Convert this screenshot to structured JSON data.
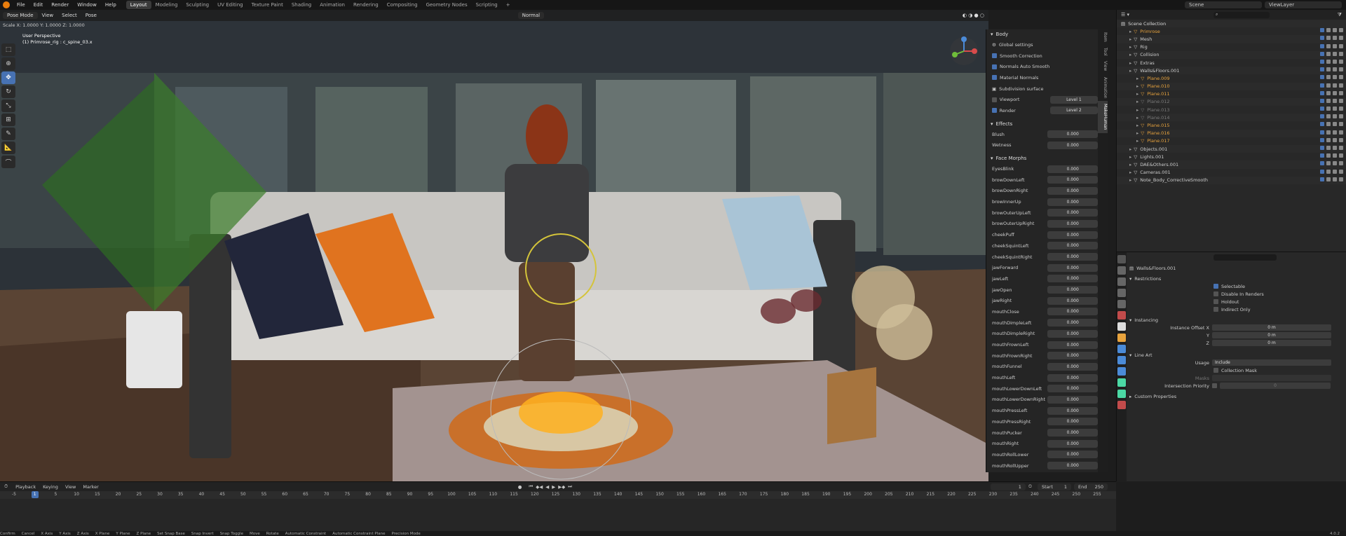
{
  "menu": [
    "File",
    "Edit",
    "Render",
    "Window",
    "Help"
  ],
  "workspaces": [
    "Layout",
    "Modeling",
    "Sculpting",
    "UV Editing",
    "Texture Paint",
    "Shading",
    "Animation",
    "Rendering",
    "Compositing",
    "Geometry Nodes",
    "Scripting",
    "+"
  ],
  "active_workspace": "Layout",
  "scene_name": "Scene",
  "view_layer": "ViewLayer",
  "viewport": {
    "mode": "Pose Mode",
    "menus": [
      "View",
      "Select",
      "Pose"
    ],
    "orientation": "Normal",
    "scale_readout": "Scale X: 1.0000   Y: 1.0000   Z: 1.0000",
    "perspective": "User Perspective",
    "active_object": "(1) Primrose_rig : c_spine_03.x"
  },
  "npanel": {
    "tabs": [
      "Item",
      "Tool",
      "View",
      "Animation",
      "MakeHuman"
    ],
    "active_tab": "MakeHuman",
    "body_title": "Body",
    "global_settings": "Global settings",
    "checks": [
      {
        "label": "Smooth Correction",
        "on": true
      },
      {
        "label": "Normals Auto Smooth",
        "on": true
      },
      {
        "label": "Material Normals",
        "on": true
      }
    ],
    "subdivision_title": "Subdivision surface",
    "subdiv": [
      {
        "label": "Viewport",
        "on": false,
        "field": "Level",
        "value": "1"
      },
      {
        "label": "Render",
        "on": true,
        "field": "Level",
        "value": "2"
      }
    ],
    "effects_title": "Effects",
    "effects": [
      {
        "label": "Blush",
        "value": "0.000"
      },
      {
        "label": "Wetness",
        "value": "0.000"
      }
    ],
    "morphs_title": "Face Morphs",
    "morphs": [
      {
        "label": "EyesBlink",
        "value": "0.000"
      },
      {
        "label": "browDownLeft",
        "value": "0.000"
      },
      {
        "label": "browDownRight",
        "value": "0.000"
      },
      {
        "label": "browInnerUp",
        "value": "0.000"
      },
      {
        "label": "browOuterUpLeft",
        "value": "0.000"
      },
      {
        "label": "browOuterUpRight",
        "value": "0.000"
      },
      {
        "label": "cheekPuff",
        "value": "0.000"
      },
      {
        "label": "cheekSquintLeft",
        "value": "0.000"
      },
      {
        "label": "cheekSquintRight",
        "value": "0.000"
      },
      {
        "label": "jawForward",
        "value": "0.000"
      },
      {
        "label": "jawLeft",
        "value": "0.000"
      },
      {
        "label": "jawOpen",
        "value": "0.000"
      },
      {
        "label": "jawRight",
        "value": "0.000"
      },
      {
        "label": "mouthClose",
        "value": "0.000"
      },
      {
        "label": "mouthDimpleLeft",
        "value": "0.000"
      },
      {
        "label": "mouthDimpleRight",
        "value": "0.000"
      },
      {
        "label": "mouthFrownLeft",
        "value": "0.000"
      },
      {
        "label": "mouthFrownRight",
        "value": "0.000"
      },
      {
        "label": "mouthFunnel",
        "value": "0.000"
      },
      {
        "label": "mouthLeft",
        "value": "0.000"
      },
      {
        "label": "mouthLowerDownLeft",
        "value": "0.000"
      },
      {
        "label": "mouthLowerDownRight",
        "value": "0.000"
      },
      {
        "label": "mouthPressLeft",
        "value": "0.000"
      },
      {
        "label": "mouthPressRight",
        "value": "0.000"
      },
      {
        "label": "mouthPucker",
        "value": "0.000"
      },
      {
        "label": "mouthRight",
        "value": "0.000"
      },
      {
        "label": "mouthRollLower",
        "value": "0.000"
      },
      {
        "label": "mouthRollUpper",
        "value": "0.000"
      }
    ]
  },
  "outliner": {
    "root": "Scene Collection",
    "rows": [
      {
        "name": "Primrose",
        "indent": 1,
        "color": "#e8a33d"
      },
      {
        "name": "Mesh",
        "indent": 1,
        "color": "#cccccc"
      },
      {
        "name": "Rig",
        "indent": 1,
        "color": "#cccccc"
      },
      {
        "name": "Collision",
        "indent": 1,
        "color": "#cccccc"
      },
      {
        "name": "Extras",
        "indent": 1,
        "color": "#cccccc"
      },
      {
        "name": "Walls&Floors.001",
        "indent": 1,
        "color": "#cccccc"
      },
      {
        "name": "Plane.009",
        "indent": 2,
        "color": "#e8a33d"
      },
      {
        "name": "Plane.010",
        "indent": 2,
        "color": "#e8a33d"
      },
      {
        "name": "Plane.011",
        "indent": 2,
        "color": "#e8a33d"
      },
      {
        "name": "Plane.012",
        "indent": 2,
        "color": "#7a7a7a"
      },
      {
        "name": "Plane.013",
        "indent": 2,
        "color": "#7a7a7a"
      },
      {
        "name": "Plane.014",
        "indent": 2,
        "color": "#7a7a7a"
      },
      {
        "name": "Plane.015",
        "indent": 2,
        "color": "#e8a33d"
      },
      {
        "name": "Plane.016",
        "indent": 2,
        "color": "#e8a33d"
      },
      {
        "name": "Plane.017",
        "indent": 2,
        "color": "#e8a33d"
      },
      {
        "name": "Objects.001",
        "indent": 1,
        "color": "#cccccc"
      },
      {
        "name": "Lights.001",
        "indent": 1,
        "color": "#cccccc"
      },
      {
        "name": "DAE&Others.001",
        "indent": 1,
        "color": "#cccccc"
      },
      {
        "name": "Cameras.001",
        "indent": 1,
        "color": "#cccccc"
      },
      {
        "name": "Note_Body_CorrectiveSmooth",
        "indent": 1,
        "color": "#cccccc"
      }
    ]
  },
  "properties": {
    "object_name": "Walls&Floors.001",
    "restrictions_title": "Restrictions",
    "restrictions": [
      {
        "label": "Selectable",
        "on": true
      },
      {
        "label": "Disable In Renders",
        "on": false
      },
      {
        "label": "Holdout",
        "on": false
      },
      {
        "label": "Indirect Only",
        "on": false
      }
    ],
    "instancing_title": "Instancing",
    "instance_offset": [
      {
        "label": "Instance Offset X",
        "value": "0 m"
      },
      {
        "label": "Y",
        "value": "0 m"
      },
      {
        "label": "Z",
        "value": "0 m"
      }
    ],
    "lineart_title": "Line Art",
    "usage_label": "Usage",
    "usage_value": "Include",
    "collection_mask": "Collection Mask",
    "masks_label": "Masks",
    "intersection_label": "Intersection Priority",
    "intersection_value": "0",
    "custom_props": "Custom Properties"
  },
  "timeline": {
    "menus": [
      "Playback",
      "Keying",
      "View",
      "Marker"
    ],
    "current_frame": "1",
    "start_label": "Start",
    "start": "1",
    "end_label": "End",
    "end": "250",
    "ticks": [
      "-5",
      "1",
      "5",
      "10",
      "15",
      "20",
      "25",
      "30",
      "35",
      "40",
      "45",
      "50",
      "55",
      "60",
      "65",
      "70",
      "75",
      "80",
      "85",
      "90",
      "95",
      "100",
      "105",
      "110",
      "115",
      "120",
      "125",
      "130",
      "135",
      "140",
      "145",
      "150",
      "155",
      "160",
      "165",
      "170",
      "175",
      "180",
      "185",
      "190",
      "195",
      "200",
      "205",
      "210",
      "215",
      "220",
      "225",
      "230",
      "235",
      "240",
      "245",
      "250",
      "255"
    ]
  },
  "status": [
    "Confirm",
    "Cancel",
    "X Axis",
    "Y Axis",
    "Z Axis",
    "X Plane",
    "Y Plane",
    "Z Plane",
    "Set Snap Base",
    "Snap Invert",
    "Snap Toggle",
    "Move",
    "Rotate",
    "Automatic Constraint",
    "Automatic Constraint Plane",
    "Precision Mode"
  ],
  "version": "4.0.2"
}
